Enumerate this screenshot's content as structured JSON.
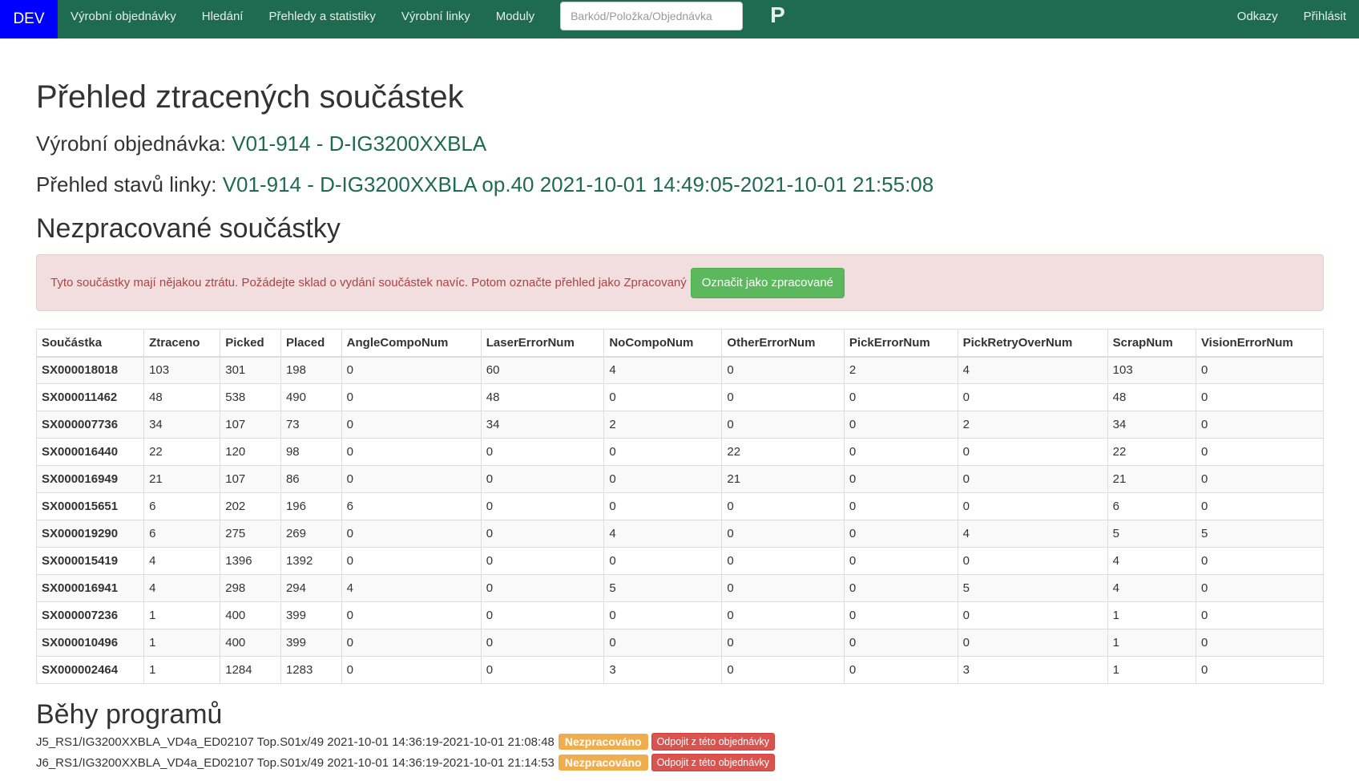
{
  "nav": {
    "brand": "DEV",
    "items": [
      "Výrobní objednávky",
      "Hledání",
      "Přehledy a statistiky",
      "Výrobní linky",
      "Moduly"
    ],
    "search_placeholder": "Barkód/Položka/Objednávka",
    "logo": "P",
    "right_items": [
      "Odkazy",
      "Přihlásit"
    ]
  },
  "page": {
    "title": "Přehled ztracených součástek",
    "order_label": "Výrobní objednávka:",
    "order_link": "V01-914 - D-IG3200XXBLA",
    "line_label": "Přehled stavů linky:",
    "line_link": "V01-914 - D-IG3200XXBLA op.40 2021-10-01 14:49:05-2021-10-01 21:55:08",
    "section_unprocessed": "Nezpracované součástky",
    "alert_text": "Tyto součástky mají nějakou ztrátu. Požádejte sklad o vydání součástek navíc. Potom označte přehled jako Zpracovaný",
    "mark_processed_button": "Označit jako zpracované",
    "section_runs": "Běhy programů"
  },
  "table": {
    "columns": [
      "Součástka",
      "Ztraceno",
      "Picked",
      "Placed",
      "AngleCompoNum",
      "LaserErrorNum",
      "NoCompoNum",
      "OtherErrorNum",
      "PickErrorNum",
      "PickRetryOverNum",
      "ScrapNum",
      "VisionErrorNum"
    ],
    "rows": [
      [
        "SX000018018",
        "103",
        "301",
        "198",
        "0",
        "60",
        "4",
        "0",
        "2",
        "4",
        "103",
        "0"
      ],
      [
        "SX000011462",
        "48",
        "538",
        "490",
        "0",
        "48",
        "0",
        "0",
        "0",
        "0",
        "48",
        "0"
      ],
      [
        "SX000007736",
        "34",
        "107",
        "73",
        "0",
        "34",
        "2",
        "0",
        "0",
        "2",
        "34",
        "0"
      ],
      [
        "SX000016440",
        "22",
        "120",
        "98",
        "0",
        "0",
        "0",
        "22",
        "0",
        "0",
        "22",
        "0"
      ],
      [
        "SX000016949",
        "21",
        "107",
        "86",
        "0",
        "0",
        "0",
        "21",
        "0",
        "0",
        "21",
        "0"
      ],
      [
        "SX000015651",
        "6",
        "202",
        "196",
        "6",
        "0",
        "0",
        "0",
        "0",
        "0",
        "6",
        "0"
      ],
      [
        "SX000019290",
        "6",
        "275",
        "269",
        "0",
        "0",
        "4",
        "0",
        "0",
        "4",
        "5",
        "5"
      ],
      [
        "SX000015419",
        "4",
        "1396",
        "1392",
        "0",
        "0",
        "0",
        "0",
        "0",
        "0",
        "4",
        "0"
      ],
      [
        "SX000016941",
        "4",
        "298",
        "294",
        "4",
        "0",
        "5",
        "0",
        "0",
        "5",
        "4",
        "0"
      ],
      [
        "SX000007236",
        "1",
        "400",
        "399",
        "0",
        "0",
        "0",
        "0",
        "0",
        "0",
        "1",
        "0"
      ],
      [
        "SX000010496",
        "1",
        "400",
        "399",
        "0",
        "0",
        "0",
        "0",
        "0",
        "0",
        "1",
        "0"
      ],
      [
        "SX000002464",
        "1",
        "1284",
        "1283",
        "0",
        "0",
        "3",
        "0",
        "0",
        "3",
        "1",
        "0"
      ]
    ]
  },
  "runs": [
    {
      "text": "J5_RS1/IG3200XXBLA_VD4a_ED02107 Top.S01x/49 2021-10-01 14:36:19-2021-10-01 21:08:48",
      "status": "Nezpracováno",
      "action": "Odpojit z této objednávky"
    },
    {
      "text": "J6_RS1/IG3200XXBLA_VD4a_ED02107 Top.S01x/49 2021-10-01 14:36:19-2021-10-01 21:14:53",
      "status": "Nezpracováno",
      "action": "Odpojit z této objednávky"
    }
  ],
  "colors": {
    "navbar": "#1f6b52",
    "brand": "#0000ff",
    "link": "#1f6b52",
    "alert_bg": "#f2dede",
    "success": "#5cb85c",
    "warning": "#f0ad4e",
    "danger": "#d9534f"
  }
}
